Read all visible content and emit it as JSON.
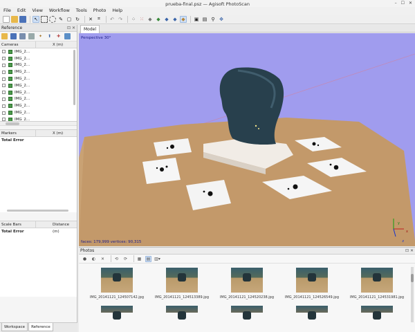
{
  "window": {
    "title": "prueba-final.psz — Agisoft PhotoScan",
    "controls": [
      "–",
      "☐",
      "✕"
    ]
  },
  "menu": [
    "File",
    "Edit",
    "View",
    "Workflow",
    "Tools",
    "Photo",
    "Help"
  ],
  "toolbar_icons": [
    "new-file-icon",
    "open-icon",
    "save-icon",
    "navigation-icon",
    "rectangle-select-icon",
    "circle-select-icon",
    "free-select-icon",
    "resize-region-icon",
    "rotate-region-icon",
    "delete-icon",
    "crop-icon",
    "undo-icon",
    "redo-icon",
    "point-cloud-icon",
    "dense-cloud-icon",
    "solid-model-icon",
    "shaded-model-icon",
    "textured-model-icon",
    "show-cameras-icon",
    "reset-view-icon",
    "show-aligned-icon",
    "navigate-icon"
  ],
  "reference": {
    "title": "Reference",
    "cameras_header": {
      "col1": "Cameras",
      "col2": "X (m)"
    },
    "cameras": [
      "IMG_2...",
      "IMG_2...",
      "IMG_2...",
      "IMG_2...",
      "IMG_2...",
      "IMG_2...",
      "IMG_2...",
      "IMG_2...",
      "IMG_2...",
      "IMG_2...",
      "IMG_2..."
    ],
    "markers_header": {
      "col1": "Markers",
      "col2": "X (m)"
    },
    "markers_total": "Total Error",
    "scalebars_header": {
      "col1": "Scale Bars",
      "col2": "Distance (m)"
    },
    "scalebars_total": "Total Error"
  },
  "bottom_tabs": [
    "Workspace",
    "Reference"
  ],
  "model": {
    "tab": "Model",
    "projection": "Perspective 30°",
    "stats": "faces: 179,999 vertices: 90,315",
    "axes": {
      "x": "x",
      "y": "y",
      "z": "z"
    }
  },
  "photos": {
    "title": "Photos",
    "items": [
      "IMG_20141121_124507142.jpg",
      "IMG_20141121_124513389.jpg",
      "IMG_20141121_124520238.jpg",
      "IMG_20141121_124526549.jpg",
      "IMG_20141121_124531981.jpg"
    ]
  }
}
